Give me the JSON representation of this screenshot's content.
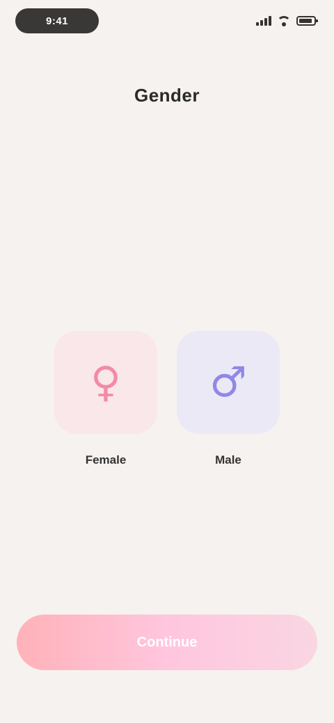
{
  "status_bar": {
    "time": "9:41"
  },
  "page": {
    "title": "Gender"
  },
  "choices": [
    {
      "label": "Female",
      "glyph": "♀",
      "color": "#f48aa8"
    },
    {
      "label": "Male",
      "glyph": "♂",
      "color": "#8f88e6"
    }
  ],
  "cta": {
    "label": "Continue"
  },
  "icons": [
    "signal-icon",
    "wifi-icon",
    "battery-icon",
    "female-icon",
    "male-icon"
  ]
}
